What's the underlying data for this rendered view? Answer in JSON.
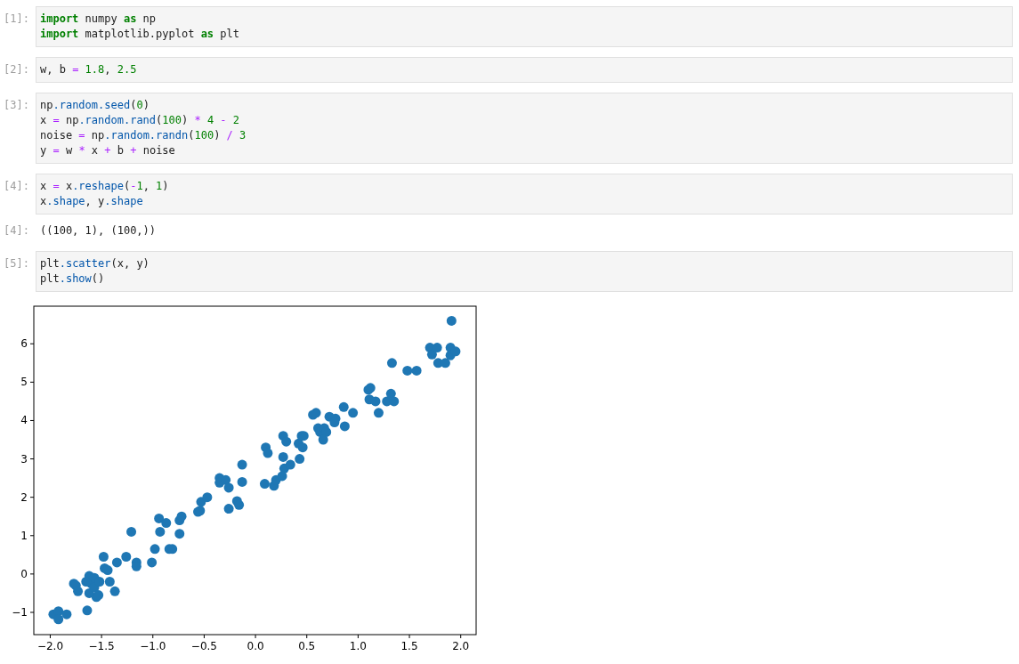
{
  "cells": [
    {
      "prompt": "[1]:",
      "lines": [
        [
          {
            "kind": "keyword",
            "text": "import"
          },
          {
            "kind": "name",
            "text": " numpy "
          },
          {
            "kind": "keyword",
            "text": "as"
          },
          {
            "kind": "name",
            "text": " np"
          }
        ],
        [
          {
            "kind": "keyword",
            "text": "import"
          },
          {
            "kind": "name",
            "text": " matplotlib.pyplot "
          },
          {
            "kind": "keyword",
            "text": "as"
          },
          {
            "kind": "name",
            "text": " plt"
          }
        ]
      ]
    },
    {
      "prompt": "[2]:",
      "lines": [
        [
          {
            "kind": "name",
            "text": "w, b "
          },
          {
            "kind": "operator",
            "text": "="
          },
          {
            "kind": "number",
            "text": " 1.8"
          },
          {
            "kind": "name",
            "text": ", "
          },
          {
            "kind": "number",
            "text": "2.5"
          }
        ]
      ]
    },
    {
      "prompt": "[3]:",
      "lines": [
        [
          {
            "kind": "name",
            "text": "np"
          },
          {
            "kind": "attribute",
            "text": ".random.seed"
          },
          {
            "kind": "name",
            "text": "("
          },
          {
            "kind": "number",
            "text": "0"
          },
          {
            "kind": "name",
            "text": ")"
          }
        ],
        [
          {
            "kind": "name",
            "text": "x "
          },
          {
            "kind": "operator",
            "text": "="
          },
          {
            "kind": "name",
            "text": " np"
          },
          {
            "kind": "attribute",
            "text": ".random.rand"
          },
          {
            "kind": "name",
            "text": "("
          },
          {
            "kind": "number",
            "text": "100"
          },
          {
            "kind": "name",
            "text": ") "
          },
          {
            "kind": "operator",
            "text": "*"
          },
          {
            "kind": "number",
            "text": " 4"
          },
          {
            "kind": "operator",
            "text": " -"
          },
          {
            "kind": "number",
            "text": " 2"
          }
        ],
        [
          {
            "kind": "name",
            "text": "noise "
          },
          {
            "kind": "operator",
            "text": "="
          },
          {
            "kind": "name",
            "text": " np"
          },
          {
            "kind": "attribute",
            "text": ".random.randn"
          },
          {
            "kind": "name",
            "text": "("
          },
          {
            "kind": "number",
            "text": "100"
          },
          {
            "kind": "name",
            "text": ") "
          },
          {
            "kind": "operator",
            "text": "/"
          },
          {
            "kind": "number",
            "text": " 3"
          }
        ],
        [
          {
            "kind": "name",
            "text": "y "
          },
          {
            "kind": "operator",
            "text": "="
          },
          {
            "kind": "name",
            "text": " w "
          },
          {
            "kind": "operator",
            "text": "*"
          },
          {
            "kind": "name",
            "text": " x "
          },
          {
            "kind": "operator",
            "text": "+"
          },
          {
            "kind": "name",
            "text": " b "
          },
          {
            "kind": "operator",
            "text": "+"
          },
          {
            "kind": "name",
            "text": " noise"
          }
        ]
      ]
    },
    {
      "prompt": "[4]:",
      "lines": [
        [
          {
            "kind": "name",
            "text": "x "
          },
          {
            "kind": "operator",
            "text": "="
          },
          {
            "kind": "name",
            "text": " x"
          },
          {
            "kind": "attribute",
            "text": ".reshape"
          },
          {
            "kind": "name",
            "text": "("
          },
          {
            "kind": "operator",
            "text": "-"
          },
          {
            "kind": "number",
            "text": "1"
          },
          {
            "kind": "name",
            "text": ", "
          },
          {
            "kind": "number",
            "text": "1"
          },
          {
            "kind": "name",
            "text": ")"
          }
        ],
        [
          {
            "kind": "name",
            "text": "x"
          },
          {
            "kind": "attribute",
            "text": ".shape"
          },
          {
            "kind": "name",
            "text": ", y"
          },
          {
            "kind": "attribute",
            "text": ".shape"
          }
        ]
      ],
      "output": {
        "prompt": "[4]:",
        "text": "((100, 1), (100,))"
      }
    },
    {
      "prompt": "[5]:",
      "lines": [
        [
          {
            "kind": "name",
            "text": "plt"
          },
          {
            "kind": "attribute",
            "text": ".scatter"
          },
          {
            "kind": "name",
            "text": "(x, y)"
          }
        ],
        [
          {
            "kind": "name",
            "text": "plt"
          },
          {
            "kind": "attribute",
            "text": ".show"
          },
          {
            "kind": "name",
            "text": "()"
          }
        ]
      ],
      "output": {
        "chart_data": {
          "type": "scatter",
          "xlim": [
            -2.16,
            2.15
          ],
          "ylim": [
            -1.58,
            6.98
          ],
          "xticks": [
            {
              "value": -2,
              "label": "−2.0"
            },
            {
              "value": -1.5,
              "label": "−1.5"
            },
            {
              "value": -1,
              "label": "−1.0"
            },
            {
              "value": -0.5,
              "label": "−0.5"
            },
            {
              "value": 0,
              "label": "0.0"
            },
            {
              "value": 0.5,
              "label": "0.5"
            },
            {
              "value": 1,
              "label": "1.0"
            },
            {
              "value": 1.5,
              "label": "1.5"
            },
            {
              "value": 2,
              "label": "2.0"
            }
          ],
          "yticks": [
            {
              "value": -1,
              "label": "−1"
            },
            {
              "value": 0,
              "label": "0"
            },
            {
              "value": 1,
              "label": "1"
            },
            {
              "value": 2,
              "label": "2"
            },
            {
              "value": 3,
              "label": "3"
            },
            {
              "value": 4,
              "label": "4"
            },
            {
              "value": 5,
              "label": "5"
            },
            {
              "value": 6,
              "label": "6"
            }
          ],
          "series": [
            {
              "color": "#1f77b4",
              "x": [
                -1.97,
                -1.92,
                -1.92,
                -1.84,
                -1.77,
                -1.75,
                -1.73,
                -1.64,
                -1.62,
                -1.62,
                -1.6,
                -1.65,
                -1.57,
                -1.57,
                -1.55,
                -1.53,
                -1.52,
                -1.48,
                -1.47,
                -1.44,
                -1.42,
                -1.37,
                -1.35,
                -1.26,
                -1.21,
                -1.16,
                -1.16,
                -1.01,
                -0.98,
                -0.94,
                -0.93,
                -0.87,
                -0.84,
                -0.81,
                -0.74,
                -0.74,
                -0.72,
                -0.56,
                -0.54,
                -0.53,
                -0.47,
                -0.35,
                -0.35,
                -0.29,
                -0.26,
                -0.26,
                -0.18,
                -0.16,
                -0.13,
                -0.13,
                0.1,
                0.12,
                0.09,
                0.18,
                0.2,
                0.27,
                0.3,
                0.27,
                0.28,
                0.26,
                0.34,
                0.42,
                0.43,
                0.45,
                0.47,
                0.46,
                0.56,
                0.59,
                0.61,
                0.63,
                0.67,
                0.69,
                0.66,
                0.72,
                0.78,
                0.77,
                0.86,
                0.87,
                0.95,
                1.1,
                1.12,
                1.11,
                1.17,
                1.2,
                1.28,
                1.32,
                1.35,
                1.33,
                1.48,
                1.57,
                1.7,
                1.72,
                1.77,
                1.78,
                1.85,
                1.9,
                1.9,
                1.95,
                1.91
              ],
              "values": [
                -1.05,
                -0.97,
                -1.18,
                -1.05,
                -0.25,
                -0.3,
                -0.45,
                -0.95,
                -0.05,
                -0.5,
                -0.25,
                -0.2,
                -0.1,
                -0.35,
                -0.6,
                -0.55,
                -0.2,
                0.45,
                0.15,
                0.1,
                -0.2,
                -0.45,
                0.3,
                0.45,
                1.1,
                0.3,
                0.2,
                0.3,
                0.65,
                1.45,
                1.1,
                1.33,
                0.65,
                0.65,
                1.05,
                1.4,
                1.5,
                1.62,
                1.65,
                1.88,
                2.0,
                2.5,
                2.38,
                2.45,
                2.25,
                1.7,
                1.9,
                1.8,
                2.4,
                2.85,
                3.3,
                3.15,
                2.35,
                2.3,
                2.45,
                3.6,
                3.45,
                3.05,
                2.75,
                2.55,
                2.85,
                3.4,
                3.0,
                3.6,
                3.6,
                3.3,
                4.15,
                4.2,
                3.8,
                3.7,
                3.8,
                3.7,
                3.5,
                4.1,
                4.05,
                3.95,
                4.35,
                3.85,
                4.2,
                4.8,
                4.85,
                4.55,
                4.5,
                4.2,
                4.5,
                4.7,
                4.5,
                5.5,
                5.3,
                5.3,
                5.9,
                5.72,
                5.9,
                5.5,
                5.5,
                5.9,
                5.7,
                5.8,
                6.6
              ]
            }
          ]
        }
      }
    }
  ]
}
